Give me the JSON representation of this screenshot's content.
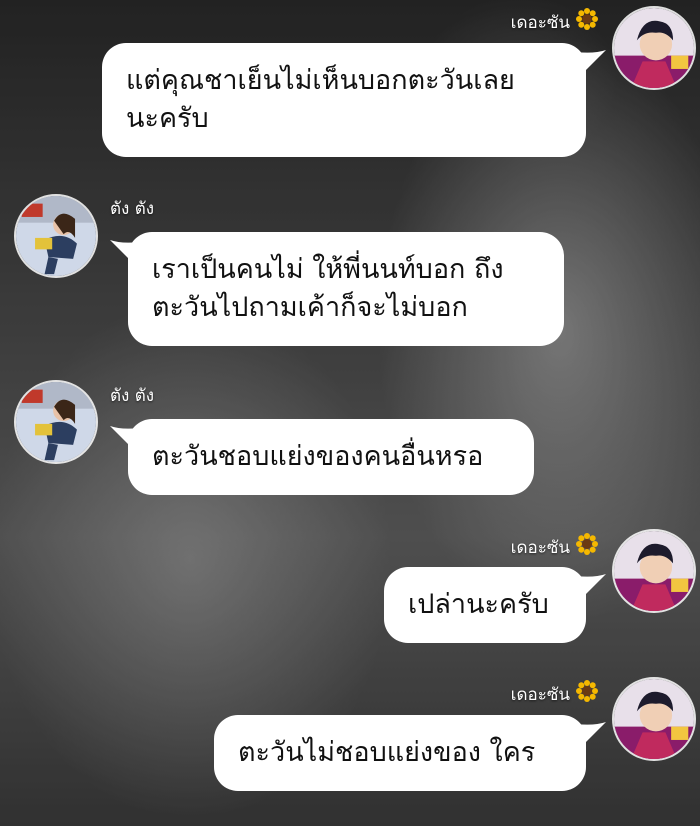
{
  "users": {
    "right": {
      "name": "เดอะซัน",
      "emoji": "🌻"
    },
    "left": {
      "name": "ตัง ตัง"
    }
  },
  "messages": [
    {
      "side": "right",
      "lines": [
        "แต่คุณชาเย็นไม่เห็นบอกตะวันเลย",
        "นะครับ"
      ]
    },
    {
      "side": "left",
      "lines": [
        "เราเป็นคนไม่ ให้พี่นนท์บอก ถึง",
        "ตะวันไปถามเค้าก็จะไม่บอก"
      ]
    },
    {
      "side": "left",
      "lines": [
        "ตะวันชอบแย่งของคนอื่นหรอ"
      ]
    },
    {
      "side": "right",
      "lines": [
        "เปล่านะครับ"
      ]
    },
    {
      "side": "right",
      "lines": [
        "ตะวันไม่ชอบแย่งของ ใคร"
      ]
    }
  ],
  "colors": {
    "bubble": "#ffffff",
    "text": "#111111",
    "name": "#ffffff"
  },
  "icons": [
    "sunflower-icon",
    "avatar-the-sun",
    "avatar-tang-tang"
  ]
}
